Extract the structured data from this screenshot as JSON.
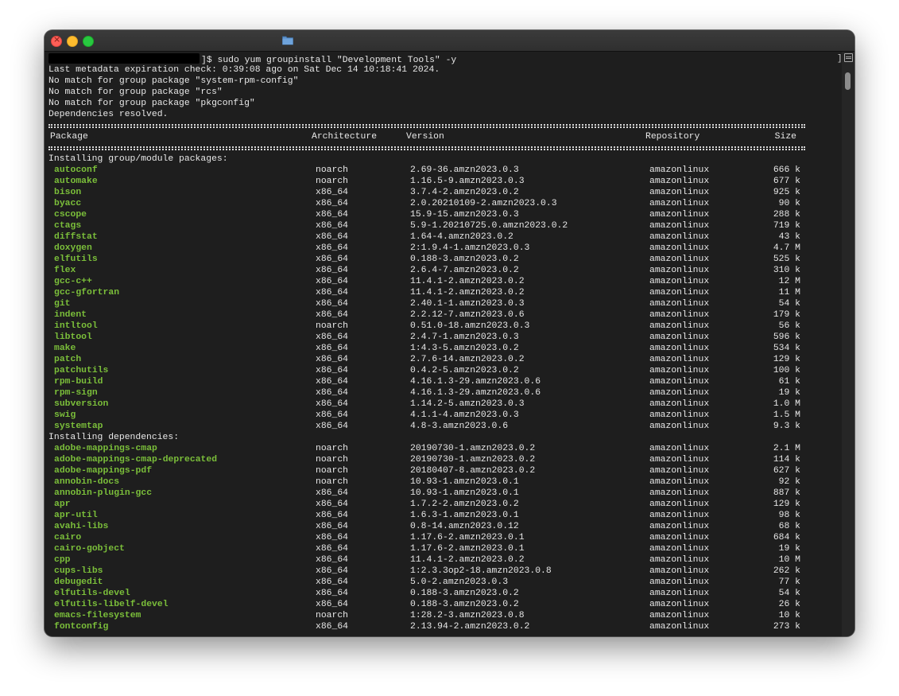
{
  "prompt": {
    "command": "]$ sudo yum groupinstall \"Development Tools\" -y"
  },
  "messages": [
    "Last metadata expiration check: 0:39:08 ago on Sat Dec 14 10:18:41 2024.",
    "No match for group package \"system-rpm-config\"",
    "No match for group package \"rcs\"",
    "No match for group package \"pkgconfig\"",
    "Dependencies resolved."
  ],
  "table_header": {
    "package": "Package",
    "architecture": "Architecture",
    "version": "Version",
    "repository": "Repository",
    "size": "Size"
  },
  "sections": {
    "group": "Installing group/module packages:",
    "deps": "Installing dependencies:"
  },
  "group_packages": [
    [
      "autoconf",
      "noarch",
      "2.69-36.amzn2023.0.3",
      "amazonlinux",
      "666 k"
    ],
    [
      "automake",
      "noarch",
      "1.16.5-9.amzn2023.0.3",
      "amazonlinux",
      "677 k"
    ],
    [
      "bison",
      "x86_64",
      "3.7.4-2.amzn2023.0.2",
      "amazonlinux",
      "925 k"
    ],
    [
      "byacc",
      "x86_64",
      "2.0.20210109-2.amzn2023.0.3",
      "amazonlinux",
      "90 k"
    ],
    [
      "cscope",
      "x86_64",
      "15.9-15.amzn2023.0.3",
      "amazonlinux",
      "288 k"
    ],
    [
      "ctags",
      "x86_64",
      "5.9-1.20210725.0.amzn2023.0.2",
      "amazonlinux",
      "719 k"
    ],
    [
      "diffstat",
      "x86_64",
      "1.64-4.amzn2023.0.2",
      "amazonlinux",
      "43 k"
    ],
    [
      "doxygen",
      "x86_64",
      "2:1.9.4-1.amzn2023.0.3",
      "amazonlinux",
      "4.7 M"
    ],
    [
      "elfutils",
      "x86_64",
      "0.188-3.amzn2023.0.2",
      "amazonlinux",
      "525 k"
    ],
    [
      "flex",
      "x86_64",
      "2.6.4-7.amzn2023.0.2",
      "amazonlinux",
      "310 k"
    ],
    [
      "gcc-c++",
      "x86_64",
      "11.4.1-2.amzn2023.0.2",
      "amazonlinux",
      "12 M"
    ],
    [
      "gcc-gfortran",
      "x86_64",
      "11.4.1-2.amzn2023.0.2",
      "amazonlinux",
      "11 M"
    ],
    [
      "git",
      "x86_64",
      "2.40.1-1.amzn2023.0.3",
      "amazonlinux",
      "54 k"
    ],
    [
      "indent",
      "x86_64",
      "2.2.12-7.amzn2023.0.6",
      "amazonlinux",
      "179 k"
    ],
    [
      "intltool",
      "noarch",
      "0.51.0-18.amzn2023.0.3",
      "amazonlinux",
      "56 k"
    ],
    [
      "libtool",
      "x86_64",
      "2.4.7-1.amzn2023.0.3",
      "amazonlinux",
      "596 k"
    ],
    [
      "make",
      "x86_64",
      "1:4.3-5.amzn2023.0.2",
      "amazonlinux",
      "534 k"
    ],
    [
      "patch",
      "x86_64",
      "2.7.6-14.amzn2023.0.2",
      "amazonlinux",
      "129 k"
    ],
    [
      "patchutils",
      "x86_64",
      "0.4.2-5.amzn2023.0.2",
      "amazonlinux",
      "100 k"
    ],
    [
      "rpm-build",
      "x86_64",
      "4.16.1.3-29.amzn2023.0.6",
      "amazonlinux",
      "61 k"
    ],
    [
      "rpm-sign",
      "x86_64",
      "4.16.1.3-29.amzn2023.0.6",
      "amazonlinux",
      "19 k"
    ],
    [
      "subversion",
      "x86_64",
      "1.14.2-5.amzn2023.0.3",
      "amazonlinux",
      "1.0 M"
    ],
    [
      "swig",
      "x86_64",
      "4.1.1-4.amzn2023.0.3",
      "amazonlinux",
      "1.5 M"
    ],
    [
      "systemtap",
      "x86_64",
      "4.8-3.amzn2023.0.6",
      "amazonlinux",
      "9.3 k"
    ]
  ],
  "dependency_packages": [
    [
      "adobe-mappings-cmap",
      "noarch",
      "20190730-1.amzn2023.0.2",
      "amazonlinux",
      "2.1 M"
    ],
    [
      "adobe-mappings-cmap-deprecated",
      "noarch",
      "20190730-1.amzn2023.0.2",
      "amazonlinux",
      "114 k"
    ],
    [
      "adobe-mappings-pdf",
      "noarch",
      "20180407-8.amzn2023.0.2",
      "amazonlinux",
      "627 k"
    ],
    [
      "annobin-docs",
      "noarch",
      "10.93-1.amzn2023.0.1",
      "amazonlinux",
      "92 k"
    ],
    [
      "annobin-plugin-gcc",
      "x86_64",
      "10.93-1.amzn2023.0.1",
      "amazonlinux",
      "887 k"
    ],
    [
      "apr",
      "x86_64",
      "1.7.2-2.amzn2023.0.2",
      "amazonlinux",
      "129 k"
    ],
    [
      "apr-util",
      "x86_64",
      "1.6.3-1.amzn2023.0.1",
      "amazonlinux",
      "98 k"
    ],
    [
      "avahi-libs",
      "x86_64",
      "0.8-14.amzn2023.0.12",
      "amazonlinux",
      "68 k"
    ],
    [
      "cairo",
      "x86_64",
      "1.17.6-2.amzn2023.0.1",
      "amazonlinux",
      "684 k"
    ],
    [
      "cairo-gobject",
      "x86_64",
      "1.17.6-2.amzn2023.0.1",
      "amazonlinux",
      "19 k"
    ],
    [
      "cpp",
      "x86_64",
      "11.4.1-2.amzn2023.0.2",
      "amazonlinux",
      "10 M"
    ],
    [
      "cups-libs",
      "x86_64",
      "1:2.3.3op2-18.amzn2023.0.8",
      "amazonlinux",
      "262 k"
    ],
    [
      "debugedit",
      "x86_64",
      "5.0-2.amzn2023.0.3",
      "amazonlinux",
      "77 k"
    ],
    [
      "elfutils-devel",
      "x86_64",
      "0.188-3.amzn2023.0.2",
      "amazonlinux",
      "54 k"
    ],
    [
      "elfutils-libelf-devel",
      "x86_64",
      "0.188-3.amzn2023.0.2",
      "amazonlinux",
      "26 k"
    ],
    [
      "emacs-filesystem",
      "noarch",
      "1:28.2-3.amzn2023.0.8",
      "amazonlinux",
      "10 k"
    ],
    [
      "fontconfig",
      "x86_64",
      "2.13.94-2.amzn2023.0.2",
      "amazonlinux",
      "273 k"
    ]
  ],
  "colors": {
    "background": "#1e1e1e",
    "text": "#e8e8e8",
    "package_green": "#7bbf3a",
    "close": "#fe5f57",
    "minimize": "#febc2e",
    "maximize": "#28c840"
  },
  "icons": {
    "titlebar": "folder-icon",
    "scroll": "split-pane-icon"
  }
}
